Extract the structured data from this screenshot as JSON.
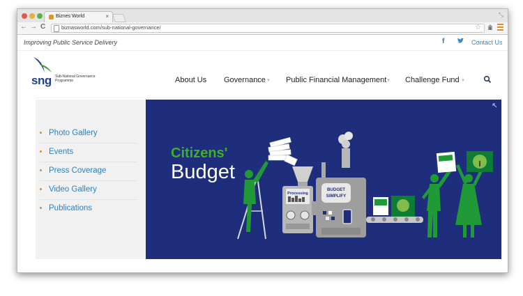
{
  "browser": {
    "tab_title": "Biznes World",
    "tab_close": "×",
    "url": "biznasworld.com/sub-national-governance/",
    "nav_back": "←",
    "nav_forward": "→",
    "nav_reload": "C"
  },
  "topbar": {
    "tagline": "Improving Public Service Delivery",
    "facebook": "f",
    "contact_label": "Contact Us"
  },
  "logo": {
    "abbr": "sng",
    "sub": "Sub-National Governance Programme"
  },
  "nav": {
    "items": [
      "About Us",
      "Governance",
      "Public Financial Management",
      "Challenge Fund"
    ]
  },
  "sidebar": {
    "items": [
      "Photo Gallery",
      "Events",
      "Press Coverage",
      "Video Gallery",
      "Publications"
    ]
  },
  "banner": {
    "line1": "Citizens'",
    "line2": "Budget",
    "machine_label1": "Processing",
    "machine_label2a": "BUDGET",
    "machine_label2b": "SIMPLIFY",
    "colors": {
      "background": "#1f2e7c",
      "green": "#1f9a37",
      "gray": "#9a9a9a"
    }
  }
}
